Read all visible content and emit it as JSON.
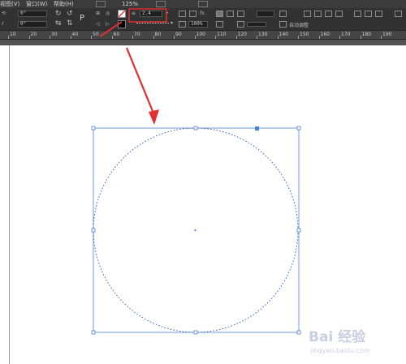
{
  "menu": {
    "view": "视图(V)",
    "window": "窗口(W)",
    "help": "帮助(H)",
    "zoom": "125%"
  },
  "toolbar": {
    "rotate_value": "0°",
    "shear_value": "0°",
    "stroke_weight": "2.4",
    "opacity_value": "100%",
    "auto_fit_label": "自动调整",
    "char_p": "P"
  },
  "ruler": {
    "ticks": [
      "10",
      "20",
      "30",
      "40",
      "50",
      "60",
      "70",
      "80",
      "90",
      "100",
      "110",
      "120",
      "130",
      "140",
      "150",
      "160",
      "170",
      "180",
      "190"
    ]
  },
  "colors": {
    "selection": "#4a7fdf",
    "annotation": "#e03030"
  },
  "watermark": {
    "brand": "Bai 经验",
    "url": "jingyan.baidu.com"
  }
}
